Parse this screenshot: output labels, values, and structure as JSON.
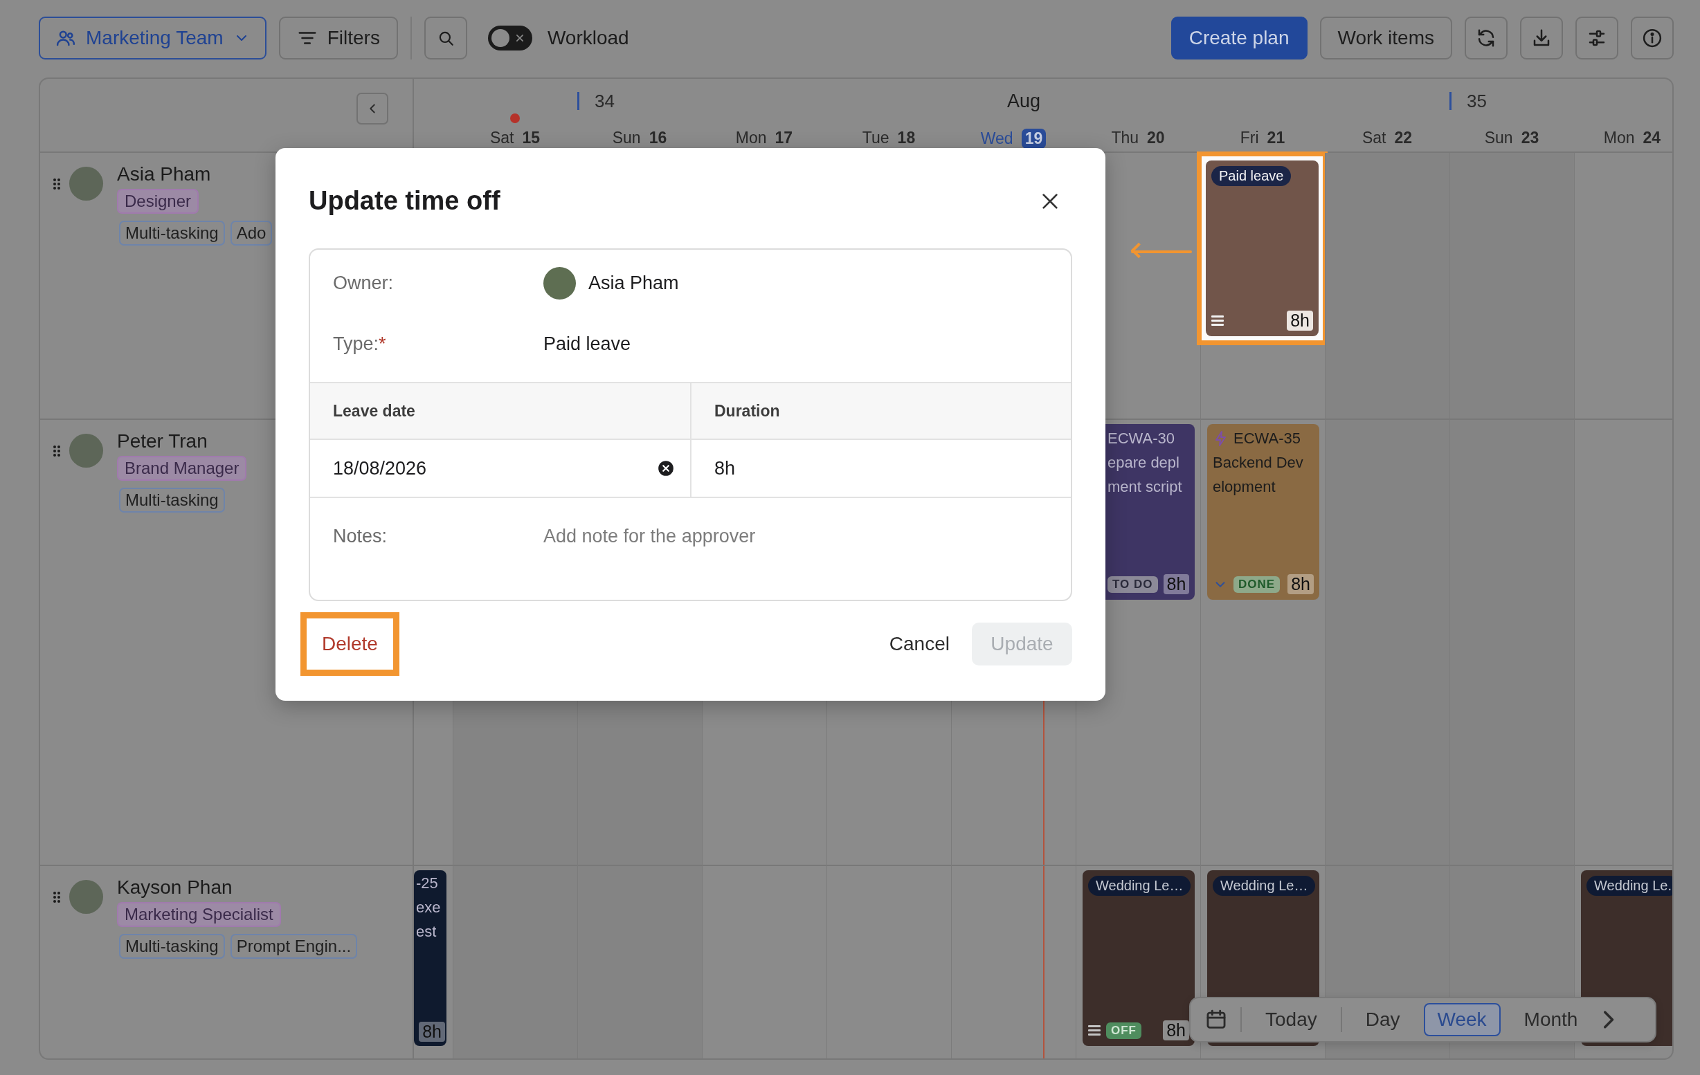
{
  "toolbar": {
    "team_button": {
      "label": "Marketing Team"
    },
    "filters_button": {
      "label": "Filters"
    },
    "workload_toggle": {
      "label": "Workload",
      "on": false
    },
    "create_plan_button": {
      "label": "Create plan"
    },
    "work_items_button": {
      "label": "Work items"
    }
  },
  "calendar": {
    "days": [
      {
        "kind": "blank"
      },
      {
        "kind": "day",
        "weekday": "Sat",
        "date": "15",
        "weekend": true,
        "today": false,
        "marked": true
      },
      {
        "kind": "day",
        "weekday": "Sun",
        "date": "16",
        "weekend": true,
        "today": false,
        "marked": false,
        "week": "34"
      },
      {
        "kind": "day",
        "weekday": "Mon",
        "date": "17",
        "weekend": false,
        "today": false,
        "marked": false
      },
      {
        "kind": "day",
        "weekday": "Tue",
        "date": "18",
        "weekend": false,
        "today": false,
        "marked": false
      },
      {
        "kind": "day",
        "weekday": "Wed",
        "date": "19",
        "weekend": false,
        "today": true,
        "marked": false,
        "month": "Aug"
      },
      {
        "kind": "day",
        "weekday": "Thu",
        "date": "20",
        "weekend": false,
        "today": false,
        "marked": false
      },
      {
        "kind": "day",
        "weekday": "Fri",
        "date": "21",
        "weekend": false,
        "today": false,
        "marked": false
      },
      {
        "kind": "day",
        "weekday": "Sat",
        "date": "22",
        "weekend": true,
        "today": false,
        "marked": false
      },
      {
        "kind": "day",
        "weekday": "Sun",
        "date": "23",
        "weekend": true,
        "today": false,
        "marked": false,
        "week": "35"
      },
      {
        "kind": "day",
        "weekday": "Mon",
        "date": "24",
        "weekend": false,
        "today": false,
        "marked": false
      }
    ],
    "people": [
      {
        "name": "Asia Pham",
        "role": "Designer",
        "skills": [
          "Multi-tasking",
          "Ado"
        ],
        "cells": [
          {
            "kind": "empty"
          },
          {
            "kind": "empty"
          },
          {
            "kind": "empty"
          },
          {
            "kind": "empty"
          },
          {
            "kind": "empty"
          },
          {
            "kind": "empty"
          },
          {
            "kind": "empty"
          },
          {
            "kind": "time_off",
            "label": "Paid leave",
            "color": "#71554a",
            "menu_icon": true,
            "hours": "8h",
            "highlighted": true,
            "callout_arrow": true
          },
          {
            "kind": "empty"
          },
          {
            "kind": "empty"
          },
          {
            "kind": "empty"
          }
        ]
      },
      {
        "name": "Peter Tran",
        "role": "Brand Manager",
        "skills": [
          "Multi-tasking"
        ],
        "cells": [
          {
            "kind": "empty"
          },
          {
            "kind": "empty"
          },
          {
            "kind": "empty"
          },
          {
            "kind": "empty"
          },
          {
            "kind": "empty"
          },
          {
            "kind": "empty"
          },
          {
            "kind": "task",
            "key": "ECWA-30",
            "title_lines": [
              "epare depl",
              "ment script"
            ],
            "color": "#3e3564",
            "clipped": true,
            "status": {
              "label": "TO DO",
              "color": "#8c8a98"
            },
            "hours": "8h"
          },
          {
            "kind": "task",
            "key": "ECWA-35",
            "title_lines": [
              "Backend Dev",
              "elopment"
            ],
            "color": "#8a6a43",
            "clipped": false,
            "status": {
              "label": "DONE",
              "color": "#8ea98a"
            },
            "hours": "8h"
          },
          {
            "kind": "empty"
          },
          {
            "kind": "empty"
          },
          {
            "kind": "empty"
          }
        ]
      },
      {
        "name": "Kayson Phan",
        "role": "Marketing Specialist",
        "skills": [
          "Multi-tasking",
          "Prompt Engin..."
        ],
        "cells": [
          {
            "kind": "task",
            "key": "-25",
            "title_lines": [
              "exe",
              "est"
            ],
            "color": "#0f1a2e",
            "clipped": true,
            "hours": "8h"
          },
          {
            "kind": "empty"
          },
          {
            "kind": "empty"
          },
          {
            "kind": "empty"
          },
          {
            "kind": "empty"
          },
          {
            "kind": "empty"
          },
          {
            "kind": "time_off",
            "label": "Wedding Le…",
            "color": "#3d2e2a",
            "menu_icon": true,
            "status": {
              "label": "OFF",
              "color": "#4f8d5e"
            },
            "hours": "8h"
          },
          {
            "kind": "time_off",
            "label": "Wedding Le…",
            "color": "#3d2e2a"
          },
          {
            "kind": "empty"
          },
          {
            "kind": "empty"
          },
          {
            "kind": "time_off",
            "label": "Wedding Le.",
            "color": "#3d2e2a"
          }
        ]
      }
    ]
  },
  "view_switcher": {
    "today_button": {
      "label": "Today"
    },
    "views": [
      {
        "label": "Day",
        "selected": false
      },
      {
        "label": "Week",
        "selected": true
      },
      {
        "label": "Month",
        "selected": false
      }
    ]
  },
  "dialog": {
    "title": "Update time off",
    "owner": {
      "label": "Owner:",
      "name": "Asia Pham"
    },
    "type": {
      "label": "Type:",
      "required_mark": "*",
      "value": "Paid leave"
    },
    "columns": [
      "Leave date",
      "Duration"
    ],
    "leave_date": "18/08/2026",
    "duration": "8h",
    "notes": {
      "label": "Notes:",
      "placeholder": "Add note for the approver"
    },
    "delete_button": {
      "label": "Delete",
      "highlighted": true
    },
    "cancel_button": {
      "label": "Cancel"
    },
    "update_button": {
      "label": "Update",
      "disabled": true
    }
  }
}
